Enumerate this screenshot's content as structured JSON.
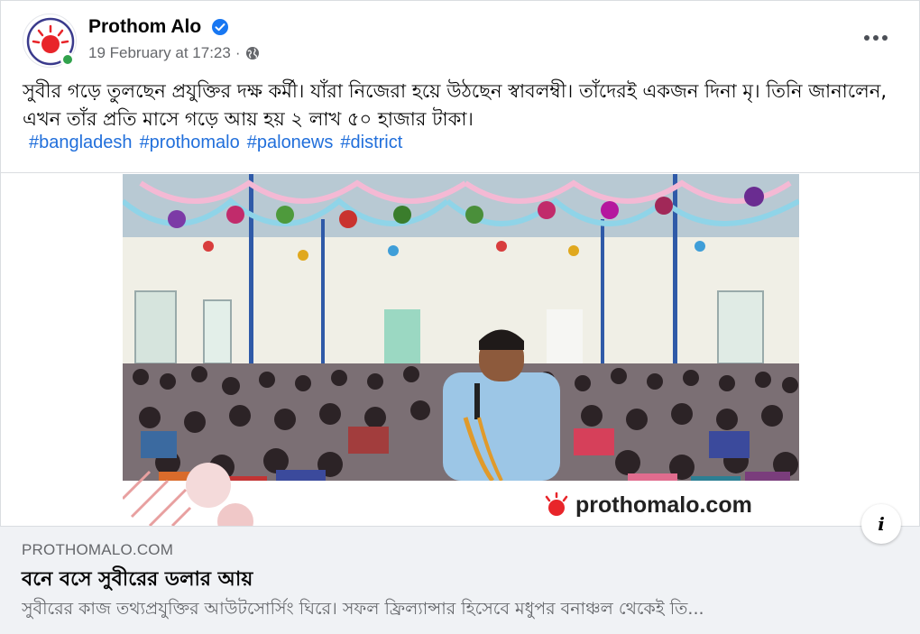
{
  "post": {
    "page_name": "Prothom Alo",
    "timestamp": "19 February at 17:23",
    "separator": "·",
    "audience_icon": "globe-icon",
    "verified_icon": "verified-badge-icon",
    "more_icon": "more-options-icon",
    "text": "সুবীর গড়ে তুলছেন প্রযুক্তির দক্ষ কর্মী। যাঁরা নিজেরা হয়ে উঠছেন স্বাবলম্বী। তাঁদেরই একজন দিনা মৃ। তিনি জানালেন, এখন তাঁর প্রতি মাসে গড়ে আয় হয় ২ লাখ ৫০ হাজার টাকা।",
    "hashtags": [
      "#bangladesh",
      "#prothomalo",
      "#palonews",
      "#district"
    ]
  },
  "image": {
    "watermark": "prothomalo.com"
  },
  "link_preview": {
    "domain": "PROTHOMALO.COM",
    "title": "বনে বসে সুবীরের ডলার আয়",
    "description": "সুবীরের কাজ তথ্যপ্রযুক্তির আউটসোর্সিং ঘিরে। সফল ফ্রিল্যান্সার হিসেবে মধুপর বনাঞ্চল থেকেই তি...",
    "info_label": "i"
  },
  "colors": {
    "brand_red": "#e8252a",
    "link_blue": "#216fdb",
    "verified_blue": "#1877f2",
    "online_green": "#31a24c",
    "secondary_text": "#65676b"
  }
}
